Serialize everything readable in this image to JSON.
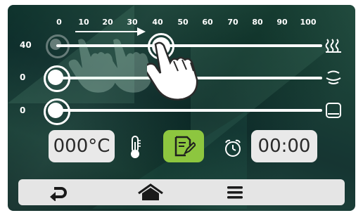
{
  "scale": {
    "ticks": [
      "0",
      "10",
      "20",
      "30",
      "40",
      "50",
      "60",
      "70",
      "80",
      "90",
      "100"
    ]
  },
  "rows": [
    {
      "label": "40",
      "icon": "top-heat-icon",
      "level_percent": 40
    },
    {
      "label": "0",
      "icon": "steam-icon",
      "level_percent": 0
    },
    {
      "label": "0",
      "icon": "bottom-heat-icon",
      "level_percent": 0
    }
  ],
  "temperature": {
    "value": "000°C",
    "icon": "thermometer-icon"
  },
  "edit": {
    "icon": "edit-note-icon",
    "accent": "#8dc63f"
  },
  "timer": {
    "value": "00:00",
    "icon": "alarm-clock-icon"
  },
  "navbar": {
    "items": [
      {
        "name": "back",
        "icon": "back-arrow-icon"
      },
      {
        "name": "home",
        "icon": "home-icon"
      },
      {
        "name": "menu",
        "icon": "menu-icon"
      }
    ]
  },
  "gesture": {
    "hint": "swipe-right-hand-icon"
  }
}
